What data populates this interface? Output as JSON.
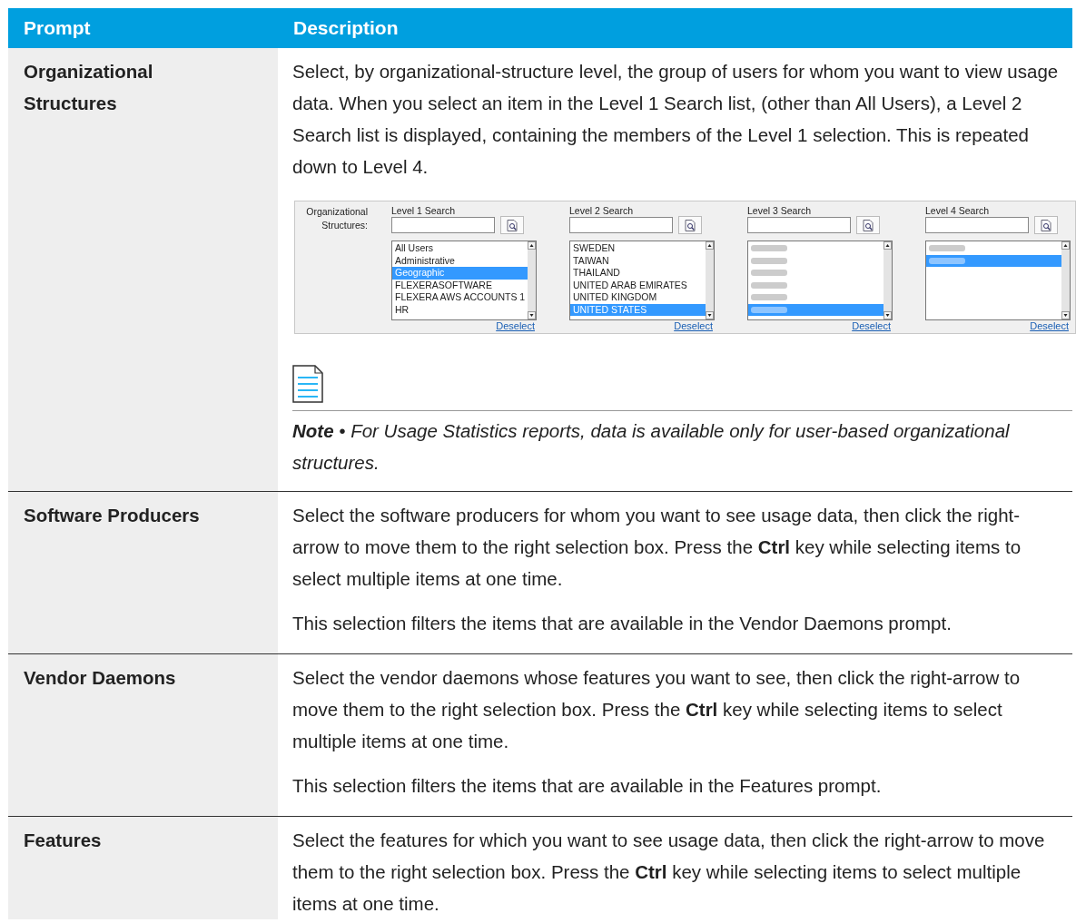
{
  "columns": [
    "Prompt",
    "Description"
  ],
  "rows": [
    {
      "prompt": "Organizational Structures",
      "paragraphs": [
        "Select, by organizational-structure level, the group of users for whom you want to view usage data. When you select an item in the Level 1 Search list, (other than All Users), a Level 2 Search list is displayed, containing the members of the Level 1 selection. This is repeated down to Level 4."
      ],
      "screenshot": {
        "label": "Organizational Structures:",
        "levels": [
          {
            "label": "Level 1 Search",
            "link": "Deselect",
            "items": [
              {
                "kind": "text",
                "text": "All Users",
                "selected": false
              },
              {
                "kind": "text",
                "text": "Administrative",
                "selected": false
              },
              {
                "kind": "text",
                "text": "Geographic",
                "selected": true
              },
              {
                "kind": "text",
                "text": "FLEXERASOFTWARE",
                "selected": false
              },
              {
                "kind": "text",
                "text": "FLEXERA AWS ACCOUNTS 1",
                "selected": false
              },
              {
                "kind": "text",
                "text": "HR",
                "selected": false
              }
            ]
          },
          {
            "label": "Level 2 Search",
            "link": "Deselect",
            "items": [
              {
                "kind": "text",
                "text": "SWEDEN",
                "selected": false
              },
              {
                "kind": "text",
                "text": "TAIWAN",
                "selected": false
              },
              {
                "kind": "text",
                "text": "THAILAND",
                "selected": false
              },
              {
                "kind": "text",
                "text": "UNITED ARAB EMIRATES",
                "selected": false
              },
              {
                "kind": "text",
                "text": "UNITED KINGDOM",
                "selected": false
              },
              {
                "kind": "text",
                "text": "UNITED STATES",
                "selected": true
              }
            ]
          },
          {
            "label": "Level 3 Search",
            "link": "Deselect",
            "items": [
              {
                "kind": "blurred",
                "selected": false
              },
              {
                "kind": "blurred",
                "selected": false
              },
              {
                "kind": "blurred",
                "selected": false
              },
              {
                "kind": "blurred",
                "selected": false
              },
              {
                "kind": "blurred",
                "selected": false
              },
              {
                "kind": "blurred",
                "selected": true
              }
            ]
          },
          {
            "label": "Level 4 Search",
            "link": "Deselect",
            "items": [
              {
                "kind": "blurred",
                "selected": false
              },
              {
                "kind": "blurred",
                "selected": true
              }
            ]
          }
        ]
      },
      "note": "**Note** • For Usage Statistics reports, data is available only for user-based organizational structures."
    },
    {
      "prompt": "Software Producers",
      "paragraphs": [
        "Select the software producers for whom you want to see usage data, then click the right-arrow to move them to the right selection box. Press the **Ctrl** key while selecting items to select multiple items at one time.",
        "This selection filters the items that are available in the Vendor Daemons prompt."
      ]
    },
    {
      "prompt": "Vendor Daemons",
      "paragraphs": [
        "Select the vendor daemons whose features you want to see, then click the right-arrow to move them to the right selection box. Press the **Ctrl** key while selecting items to select multiple items at one time.",
        "This selection filters the items that are available in the Features prompt."
      ]
    },
    {
      "prompt": "Features",
      "paragraphs": [
        "Select the features for which you want to see usage data, then click the right-arrow to move them to the right selection box. Press the **Ctrl** key while selecting items to select multiple items at one time."
      ]
    }
  ]
}
